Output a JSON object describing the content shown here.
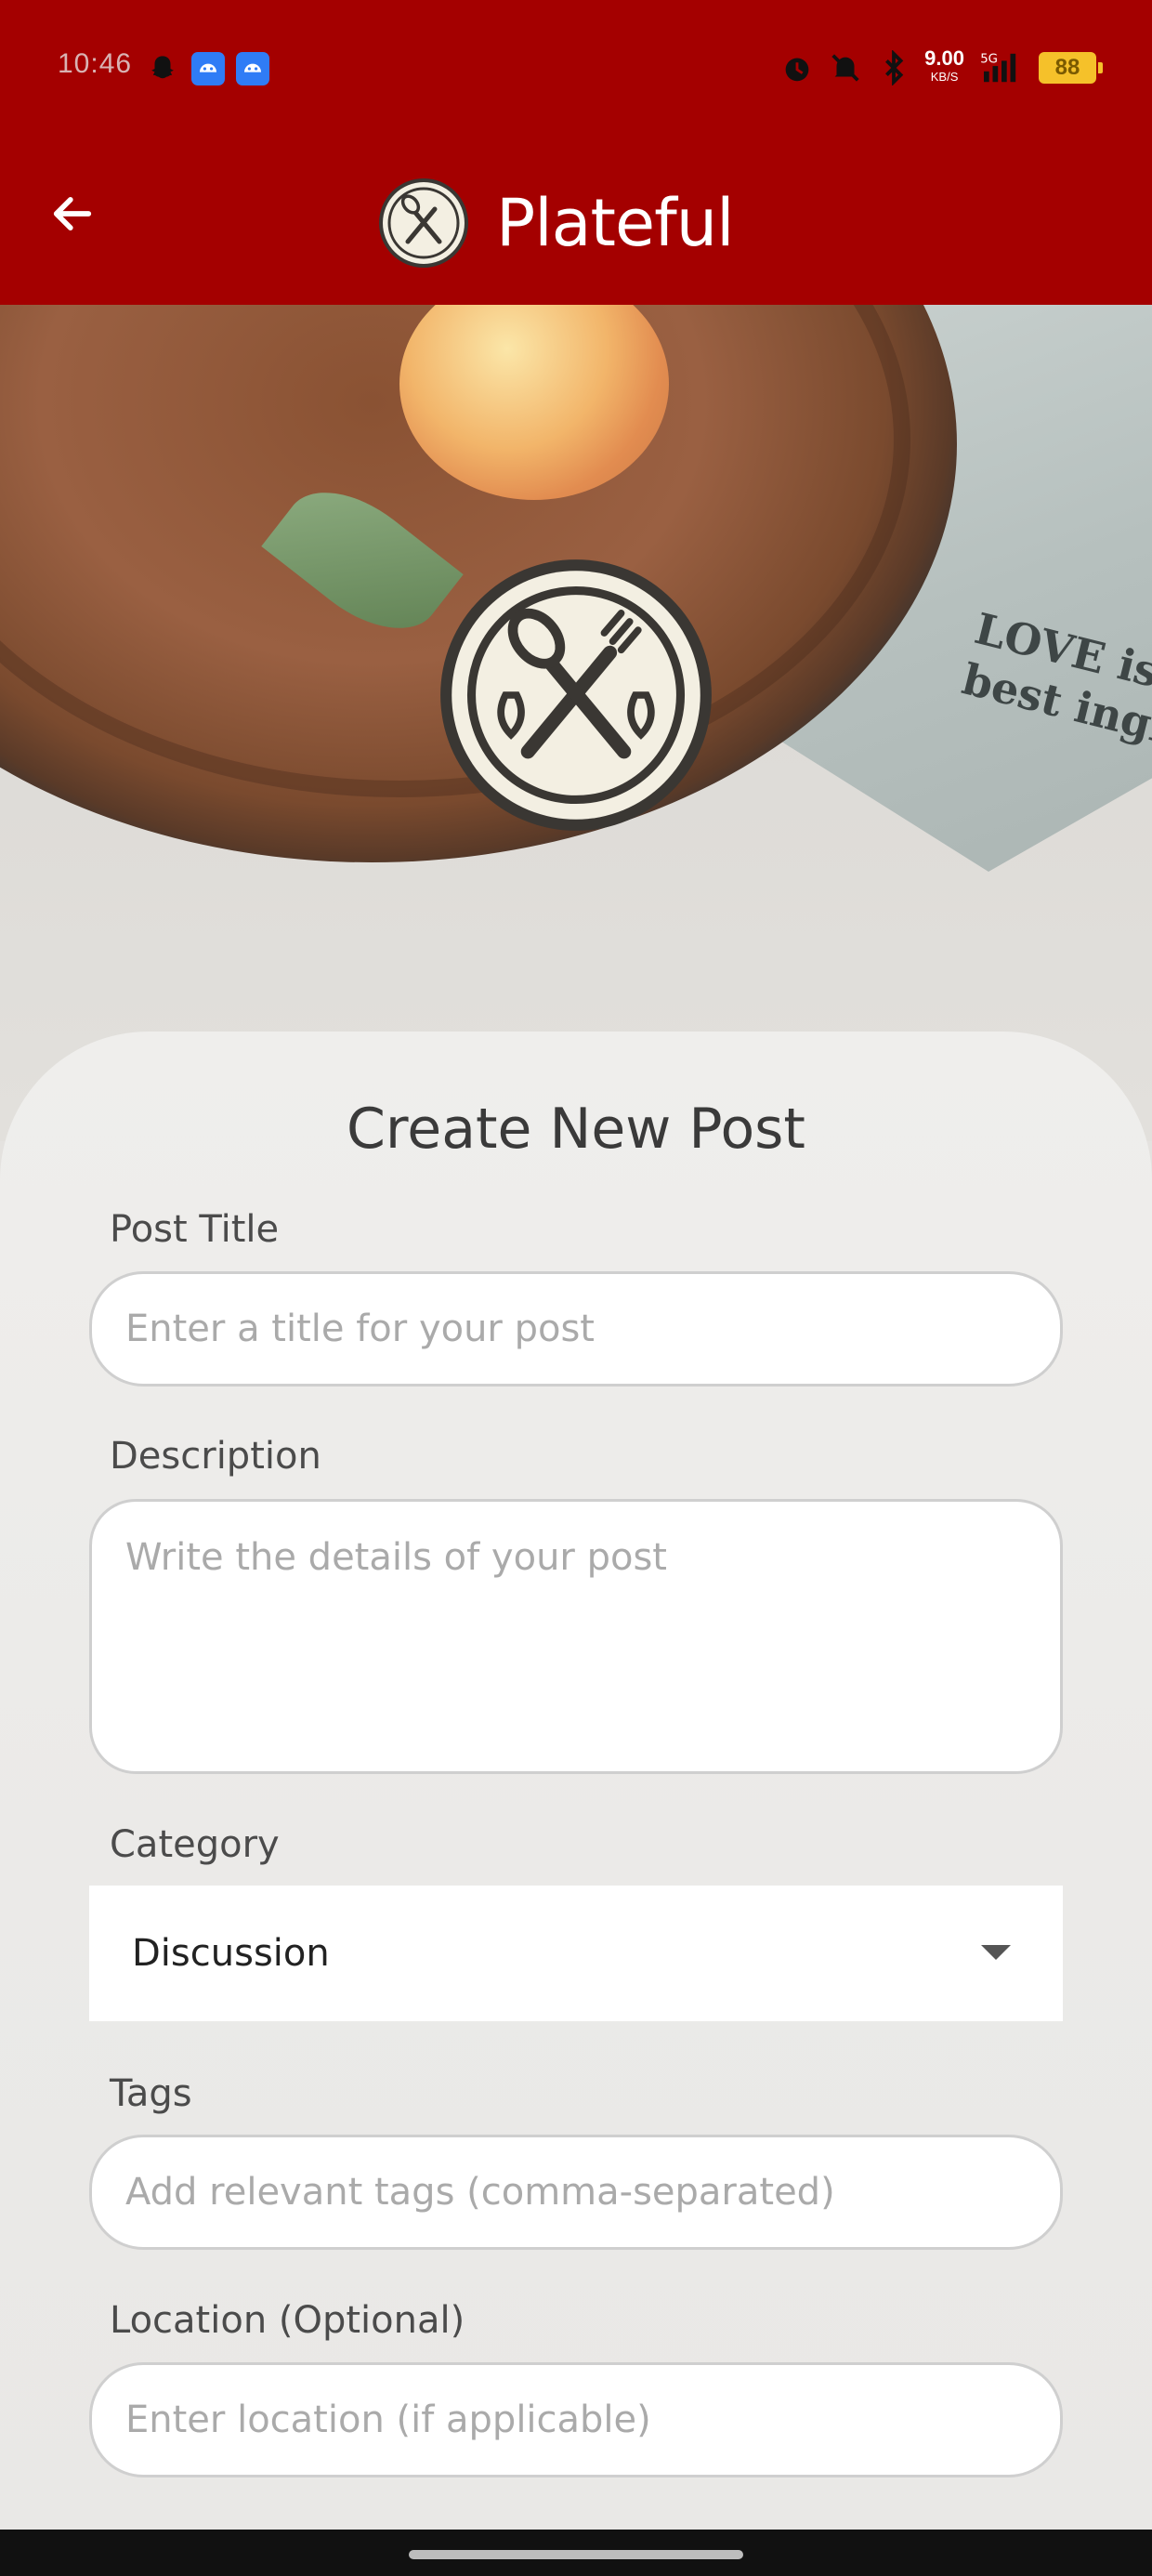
{
  "status_bar": {
    "time": "10:46",
    "speed_value": "9.00",
    "speed_unit": "KB/S",
    "network": "5G",
    "battery": "88"
  },
  "app_bar": {
    "title": "Plateful"
  },
  "hero": {
    "cloth_text_line1": "LOVE is",
    "cloth_text_line2": "best ingre"
  },
  "form": {
    "heading": "Create New Post",
    "post_title": {
      "label": "Post Title",
      "placeholder": "Enter a title for your post"
    },
    "description": {
      "label": "Description",
      "placeholder": "Write the details of your post"
    },
    "category": {
      "label": "Category",
      "selected": "Discussion"
    },
    "tags": {
      "label": "Tags",
      "placeholder": "Add relevant tags (comma-separated)"
    },
    "location": {
      "label": "Location (Optional)",
      "placeholder": "Enter location (if applicable)"
    }
  },
  "colors": {
    "app_bar": "#a40000",
    "text_dark": "#3a3a3a",
    "placeholder": "#aaaaaa"
  }
}
